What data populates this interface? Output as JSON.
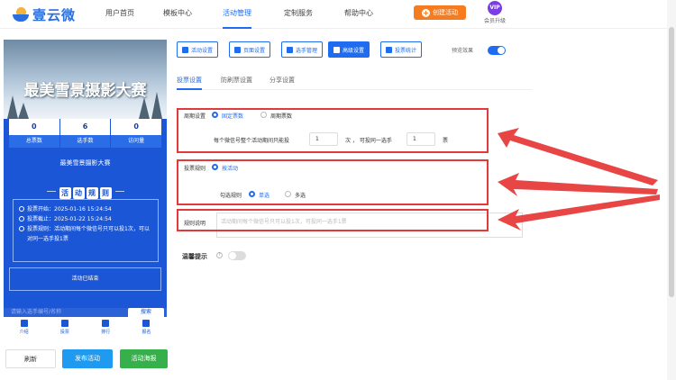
{
  "nav": {
    "logo_text": "壹云微",
    "items": [
      "用户首页",
      "模板中心",
      "活动管理",
      "定制服务",
      "帮助中心"
    ],
    "create_label": "创建活动",
    "vip_badge": "VIP",
    "vip_label": "会员升级"
  },
  "preview": {
    "banner_title": "最美雪景摄影大赛",
    "stats": [
      {
        "value": "0",
        "label": "总票数"
      },
      {
        "value": "6",
        "label": "选手数"
      },
      {
        "value": "0",
        "label": "访问量"
      }
    ],
    "activity_name": "最美雪景摄影大赛",
    "badge_chars": [
      "活",
      "动",
      "规",
      "则"
    ],
    "rules": [
      "投票开始：2025-01-16 15:24:54",
      "投票截止：2025-01-22 15:24:54",
      "投票规则：活动期间每个微信号只可以投1次，可以对同一选手投1票"
    ],
    "ended_text": "活动已结束",
    "search_placeholder": "请输入选手编号/名称",
    "search_button": "搜索",
    "tabs": [
      "介绍",
      "投票",
      "排行",
      "报名"
    ]
  },
  "bottom_buttons": {
    "refresh": "刷新",
    "publish": "发布活动",
    "poster": "活动海报"
  },
  "toolbar": {
    "buttons": [
      "活动设置",
      "页面设置",
      "选手管理",
      "高级设置",
      "投票统计"
    ],
    "active_index": 3,
    "preview_label": "预览效果",
    "preview_on": true
  },
  "subtabs": [
    "投票设置",
    "防刷票设置",
    "分享设置"
  ],
  "form": {
    "cycle_label": "周期设置",
    "cycle_options": [
      "固定票数",
      "周期票数"
    ],
    "cycle_selected": 0,
    "cycle_text_pre": "每个微信号整个活动期间只能投",
    "cycle_votes": "1",
    "cycle_text_mid": "次 ， 可投同一选手",
    "cycle_same": "1",
    "cycle_text_post": "票",
    "rule_label": "投票规则",
    "rule_option": "按活动",
    "select_label": "勾选规则",
    "select_options": [
      "单选",
      "多选"
    ],
    "select_selected": 0,
    "desc_label": "规则说明",
    "desc_placeholder": "活动期间每个微信号只可以投1次，可投同一选手1票",
    "tip_label": "温馨提示",
    "tip_on": false
  },
  "colors": {
    "primary": "#1f6cf0",
    "highlight_box": "#e23a3a",
    "create": "#f57d20",
    "poster": "#36b04a"
  }
}
